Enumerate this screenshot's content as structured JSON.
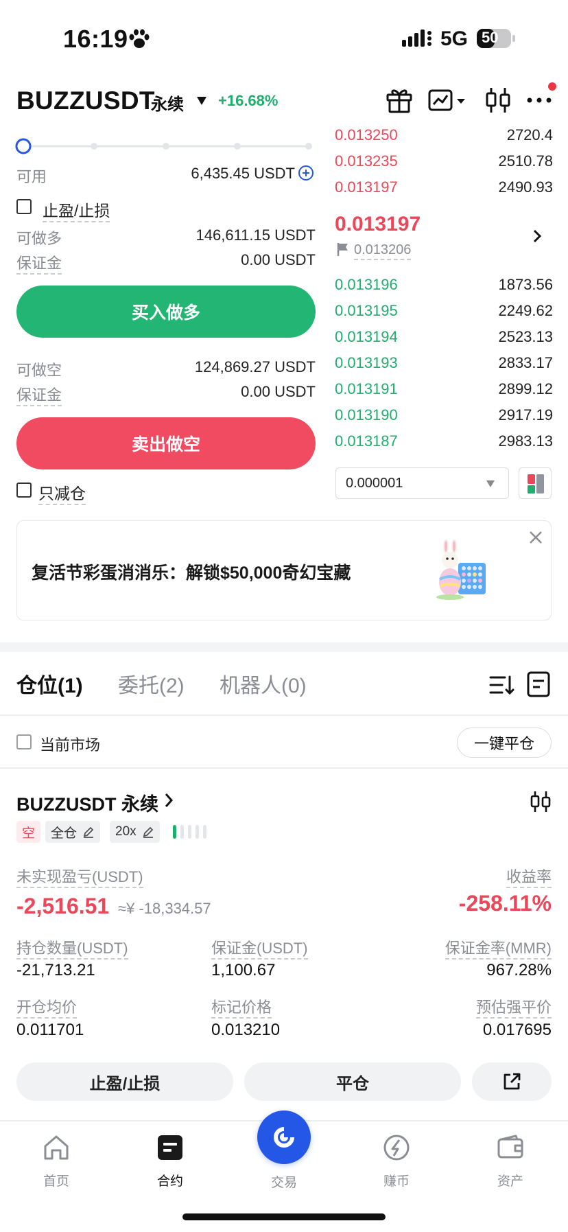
{
  "status_bar": {
    "time": "16:19",
    "network": "5G",
    "battery": "50"
  },
  "header": {
    "pair": "BUZZUSDT",
    "contract_type": "永续",
    "change": "+16.68%"
  },
  "trade_panel": {
    "slider_percent": 0,
    "available_label": "可用",
    "available_value": "6,435.45 USDT",
    "tpsl_label": "止盈/止损",
    "long": {
      "max_label": "可做多",
      "max_value": "146,611.15 USDT",
      "margin_label": "保证金",
      "margin_value": "0.00 USDT",
      "button": "买入做多"
    },
    "short": {
      "max_label": "可做空",
      "max_value": "124,869.27 USDT",
      "margin_label": "保证金",
      "margin_value": "0.00 USDT",
      "button": "卖出做空"
    },
    "reduce_only_label": "只减仓"
  },
  "order_book": {
    "asks": [
      {
        "price": "0.013250",
        "qty": "2720.4"
      },
      {
        "price": "0.013235",
        "qty": "2510.78"
      },
      {
        "price": "0.013197",
        "qty": "2490.93"
      }
    ],
    "last_price": "0.013197",
    "mark_price": "0.013206",
    "bids": [
      {
        "price": "0.013196",
        "qty": "1873.56"
      },
      {
        "price": "0.013195",
        "qty": "2249.62"
      },
      {
        "price": "0.013194",
        "qty": "2523.13"
      },
      {
        "price": "0.013193",
        "qty": "2833.17"
      },
      {
        "price": "0.013191",
        "qty": "2899.12"
      },
      {
        "price": "0.013190",
        "qty": "2917.19"
      },
      {
        "price": "0.013187",
        "qty": "2983.13"
      }
    ],
    "precision": "0.000001"
  },
  "banner": {
    "text": "复活节彩蛋消消乐：解锁$50,000奇幻宝藏"
  },
  "tabs": [
    "仓位(1)",
    "委托(2)",
    "机器人(0)"
  ],
  "filter": {
    "current_market_label": "当前市场",
    "close_all_label": "一键平仓"
  },
  "position": {
    "title": "BUZZUSDT 永续",
    "side_tag": "空",
    "margin_mode": "全仓",
    "leverage": "20x",
    "upnl_label": "未实现盈亏(USDT)",
    "upnl_value": "-2,516.51",
    "upnl_cny": "≈¥ -18,334.57",
    "roe_label": "收益率",
    "roe_value": "-258.11%",
    "size_label": "持仓数量(USDT)",
    "size_value": "-21,713.21",
    "margin_label": "保证金(USDT)",
    "margin_value": "1,100.67",
    "mmr_label": "保证金率(MMR)",
    "mmr_value": "967.28%",
    "entry_label": "开仓均价",
    "entry_value": "0.011701",
    "mark_label": "标记价格",
    "mark_value": "0.013210",
    "liq_label": "预估强平价",
    "liq_value": "0.017695",
    "tpsl_button": "止盈/止损",
    "close_button": "平仓"
  },
  "nav": {
    "home": "首页",
    "futures": "合约",
    "trade": "交易",
    "earn": "赚币",
    "assets": "资产"
  },
  "colors": {
    "green": "#1fae6e",
    "red": "#ec4659",
    "brand_blue": "#2457e6"
  }
}
